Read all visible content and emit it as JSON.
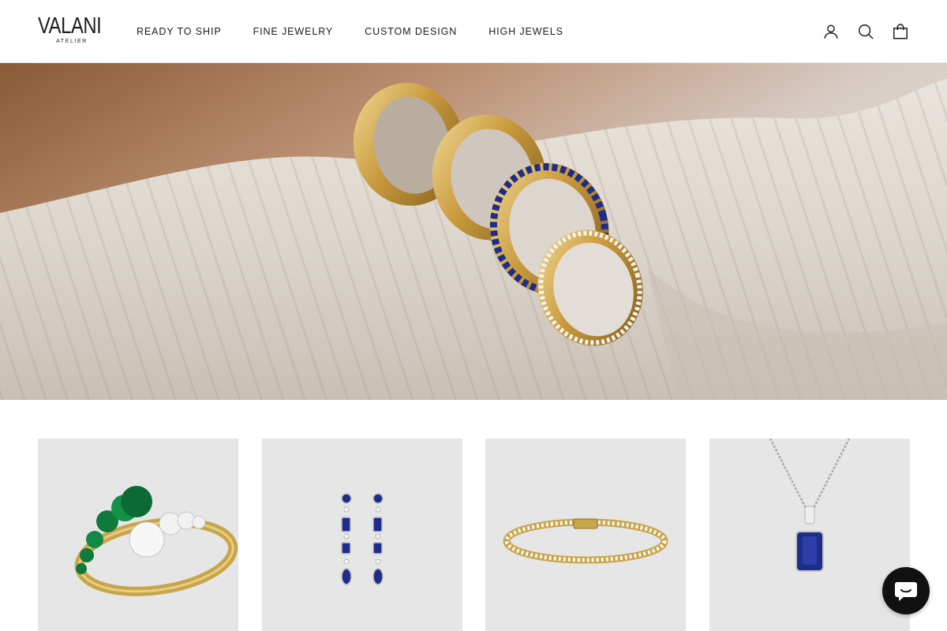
{
  "brand": {
    "name": "VALANI",
    "tagline": "ATELIER"
  },
  "nav": {
    "items": [
      {
        "label": "READY TO SHIP"
      },
      {
        "label": "FINE JEWELRY"
      },
      {
        "label": "CUSTOM DESIGN"
      },
      {
        "label": "HIGH JEWELS"
      }
    ]
  },
  "header_icons": [
    "account-icon",
    "search-icon",
    "cart-icon"
  ],
  "hero": {
    "image": "four stacked rings on cream knit fabric"
  },
  "products": [
    {
      "image": "emerald and diamond toi-et-moi ring",
      "image_bg": "#e6e6e6"
    },
    {
      "image": "sapphire drop earrings",
      "image_bg": "#e6e6e6"
    },
    {
      "image": "gold diamond tennis bracelet",
      "image_bg": "#e6e6e6"
    },
    {
      "image": "sapphire pendant necklace",
      "image_bg": "#e6e6e6"
    }
  ],
  "chat": {
    "icon": "chat-bubble-icon"
  },
  "colors": {
    "text": "#1c1c1c",
    "card_bg": "#e6e6e6",
    "chat_bg": "#111111",
    "gold": "#c9a54a",
    "sapphire": "#1f2d8a",
    "emerald": "#0f7a3c"
  }
}
